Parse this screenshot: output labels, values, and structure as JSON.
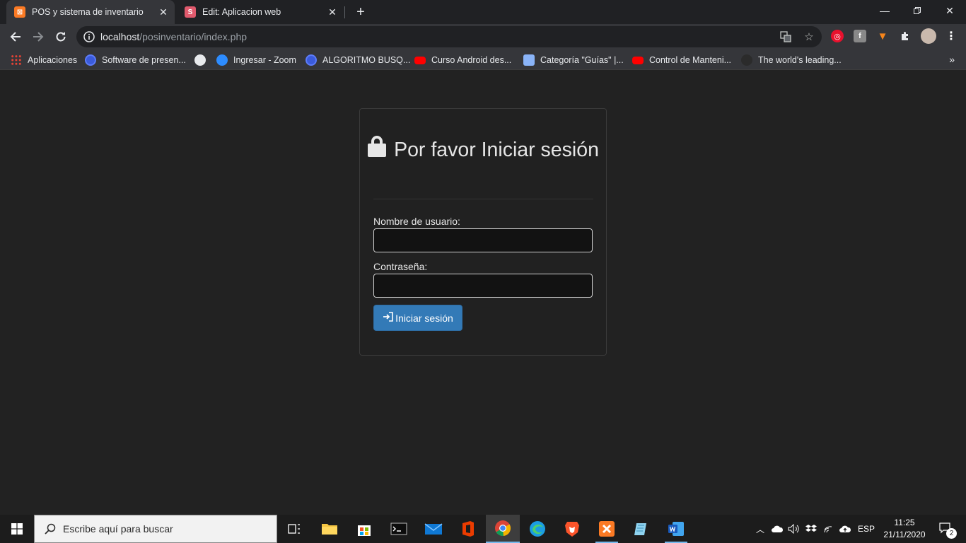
{
  "browser": {
    "tabs": [
      {
        "title": "POS y sistema de inventario",
        "favicon": "xampp-icon",
        "active": true
      },
      {
        "title": "Edit: Aplicacion web",
        "favicon": "s-letter-icon",
        "active": false
      }
    ],
    "address": {
      "host": "localhost",
      "path": "/posinventario/index.php"
    },
    "bookmarks": [
      {
        "label": "Aplicaciones",
        "icon": "apps-grid-icon"
      },
      {
        "label": "Software de presen...",
        "icon": "globe-blue-icon"
      },
      {
        "label": "",
        "icon": "globe-icon"
      },
      {
        "label": "Ingresar - Zoom",
        "icon": "zoom-icon"
      },
      {
        "label": "ALGORITMO BUSQ...",
        "icon": "globe-blue-icon"
      },
      {
        "label": "Curso Android des...",
        "icon": "youtube-icon"
      },
      {
        "label": "Categoría \"Guías\" |...",
        "icon": "site-icon"
      },
      {
        "label": "Control de Manteni...",
        "icon": "youtube-icon"
      },
      {
        "label": "The world's leading...",
        "icon": "github-icon"
      }
    ],
    "bookmarks_more": "»"
  },
  "login": {
    "title": "Por favor Iniciar sesión",
    "username_label": "Nombre de usuario:",
    "username_value": "",
    "password_label": "Contraseña:",
    "password_value": "",
    "submit_label": "Iniciar sesión",
    "submit_color": "#337ab7"
  },
  "taskbar": {
    "search_placeholder": "Escribe aquí para buscar",
    "language": "ESP",
    "time": "11:25",
    "date": "21/11/2020",
    "notifications": "2"
  }
}
